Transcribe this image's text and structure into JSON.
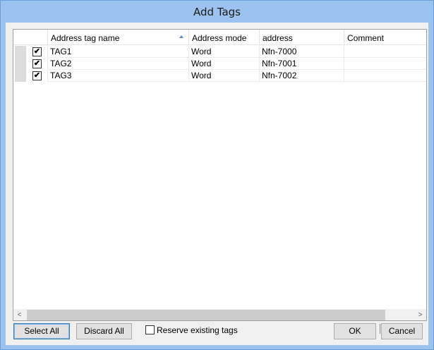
{
  "window": {
    "title": "Add Tags"
  },
  "grid": {
    "columns": {
      "name": "Address tag name",
      "mode": "Address mode",
      "address": "address",
      "comment": "Comment"
    },
    "sort_icon": "sort-ascending-icon",
    "rows": [
      {
        "checked": true,
        "check_glyph": "✔",
        "name": "TAG1",
        "mode": "Word",
        "address": "Nfn-7000",
        "comment": ""
      },
      {
        "checked": true,
        "check_glyph": "✔",
        "name": "TAG2",
        "mode": "Word",
        "address": "Nfn-7001",
        "comment": ""
      },
      {
        "checked": true,
        "check_glyph": "✔",
        "name": "TAG3",
        "mode": "Word",
        "address": "Nfn-7002",
        "comment": ""
      }
    ],
    "scroll_left_glyph": "<",
    "scroll_right_glyph": ">"
  },
  "footer": {
    "select_all": "Select All",
    "discard_all": "Discard All",
    "reserve_label": "Reserve existing tags",
    "reserve_checked": false,
    "ok": "OK",
    "cancel": "Cancel"
  },
  "colors": {
    "title_bar": "#9cc3ef",
    "row_header": "#dcdcdc",
    "focus_border": "#3c7fb1"
  }
}
